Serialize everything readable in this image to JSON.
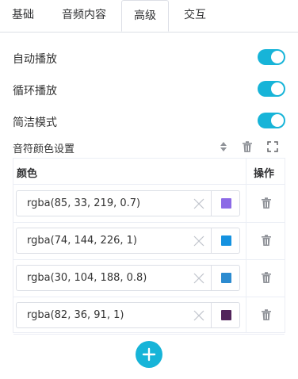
{
  "tabs": [
    {
      "label": "基础"
    },
    {
      "label": "音频内容"
    },
    {
      "label": "高级"
    },
    {
      "label": "交互"
    }
  ],
  "active_tab": "高级",
  "settings": [
    {
      "label": "自动播放",
      "on": true
    },
    {
      "label": "循环播放",
      "on": true
    },
    {
      "label": "简洁模式",
      "on": true
    }
  ],
  "accent_color": "#17b4d8",
  "note_colors": {
    "title": "音符颜色设置",
    "header_color": "颜色",
    "header_action": "操作",
    "rows": [
      {
        "value": "rgba(85, 33, 219, 0.7)",
        "swatch": "#8c6ae6"
      },
      {
        "value": "rgba(74, 144, 226, 1)",
        "swatch": "#1592e0"
      },
      {
        "value": "rgba(30, 104, 188, 0.8)",
        "swatch": "#2c8bd0"
      },
      {
        "value": "rgba(82, 36, 91, 1)",
        "swatch": "#52245b"
      }
    ]
  },
  "icons": {
    "sort": "sort-icon",
    "delete_all": "trash-icon",
    "fullscreen": "fullscreen-icon",
    "clear": "close-icon",
    "row_delete": "trash-icon",
    "add": "plus-icon"
  }
}
